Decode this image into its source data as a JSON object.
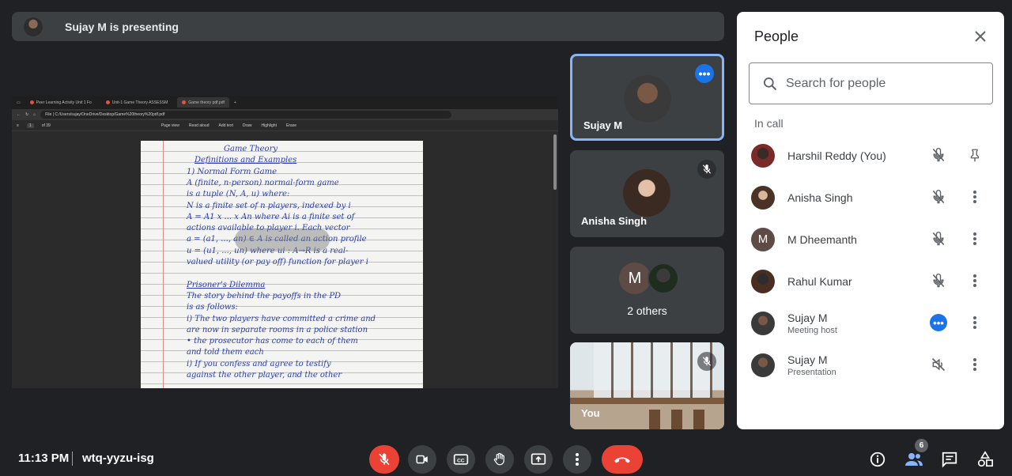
{
  "presenting": {
    "text": "Sujay M is presenting"
  },
  "shared_screen": {
    "tabs": [
      "Peer Learning Activity Unit 1 Fo",
      "Unit-1 Game Theory ASSESSM",
      "Game theory pdf.pdf"
    ],
    "url": "File  |  C:/Users/sujay/OneDrive/Desktop/Game%20theory%20pdf.pdf",
    "page_number": "1",
    "page_total": "of 39",
    "toolbar": [
      "Page view",
      "Read aloud",
      "Add text",
      "Draw",
      "Highlight",
      "Erase"
    ],
    "notes": [
      "Game Theory",
      "Definitions and Examples",
      "1) Normal Form Game",
      "A (finite, n-person) normal-form game",
      "is a tuple (N, A, u) where:",
      "N is a finite set of n players, indexed by i",
      "A = A1 x ... x An where Ai is a finite set of",
      "actions available to player i. Each vector",
      "a = (a1, ..., an) ∈ A is called an action profile",
      "u = (u1, ..., un) where ui : A→R is a real-",
      "valued utility (or pay off) function for player i",
      "",
      "Prisoner's Dilemma",
      "The story behind the payoffs in the PD",
      "is as follows:",
      "i) The two players have committed a crime and",
      "are now in separate rooms in a police station",
      "• the prosecutor has come to each of them",
      "and told them each",
      "i) If you confess and agree to testify",
      "against the other player, and the other"
    ]
  },
  "tiles": [
    {
      "name": "Sujay M"
    },
    {
      "name": "Anisha Singh"
    },
    {
      "initial": "M",
      "label": "2 others"
    },
    {
      "name": "You"
    }
  ],
  "people_panel": {
    "title": "People",
    "search_placeholder": "Search for people",
    "section": "In call",
    "people": [
      {
        "name": "Harshil Reddy (You)",
        "sub": "",
        "icon1": "mic-off-icon",
        "icon2": "pin-icon"
      },
      {
        "name": "Anisha Singh",
        "sub": "",
        "icon1": "mic-off-icon",
        "icon2": "more-vert-icon"
      },
      {
        "name": "M Dheemanth",
        "sub": "",
        "initial": "M",
        "icon1": "mic-off-icon",
        "icon2": "more-vert-icon"
      },
      {
        "name": "Rahul Kumar",
        "sub": "",
        "icon1": "mic-off-icon",
        "icon2": "more-vert-icon"
      },
      {
        "name": "Sujay M",
        "sub": "Meeting host",
        "icon1": "speaking-icon",
        "icon2": "more-vert-icon"
      },
      {
        "name": "Sujay M",
        "sub": "Presentation",
        "icon1": "volume-off-icon",
        "icon2": "more-vert-icon"
      }
    ]
  },
  "bottom_bar": {
    "time": "11:13 PM",
    "meeting_code": "wtq-yyzu-isg",
    "participants_count": "6"
  },
  "colors": {
    "background": "#202124",
    "surface": "#3c4043",
    "accent_blue": "#1a73e8",
    "danger_red": "#ea4335",
    "active_border": "#8ab4f8"
  }
}
